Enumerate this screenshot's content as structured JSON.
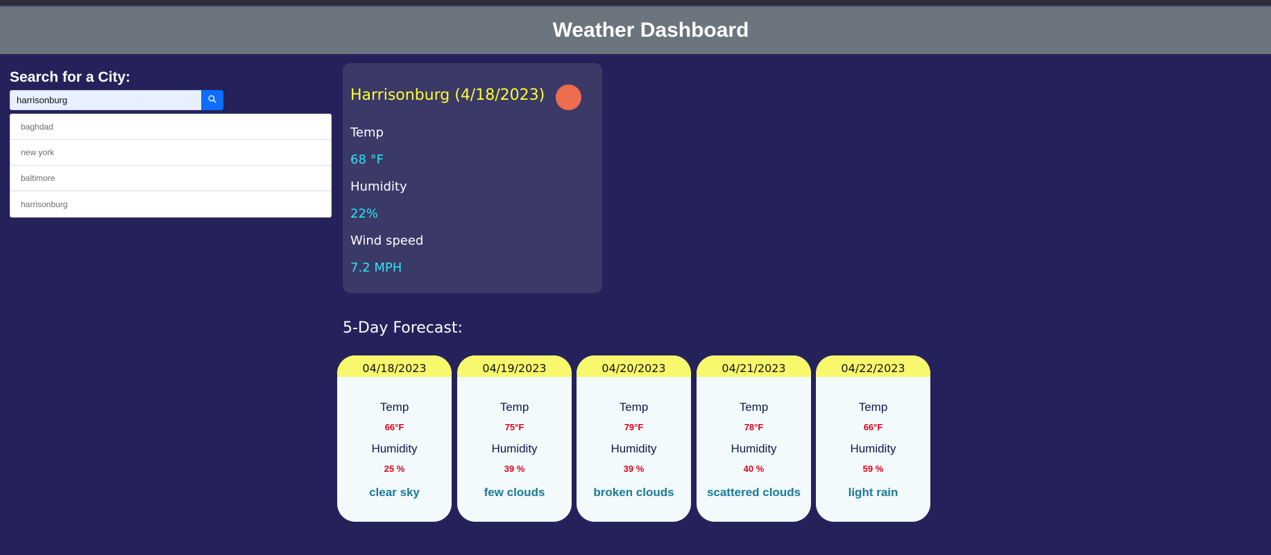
{
  "header": {
    "title": "Weather Dashboard"
  },
  "search": {
    "label": "Search for a City:",
    "value": "harrisonburg",
    "placeholder": "",
    "button_icon": "search-icon",
    "history": [
      "baghdad",
      "new york",
      "baltimore",
      "harrisonburg"
    ]
  },
  "current": {
    "title": "Harrisonburg (4/18/2023)",
    "icon": "weather-icon",
    "temp_label": "Temp",
    "temp_value": "68 °F",
    "humidity_label": "Humidity",
    "humidity_value": "22%",
    "wind_label": "Wind speed",
    "wind_value": "7.2 MPH"
  },
  "forecast": {
    "title": "5-Day Forecast:",
    "days": [
      {
        "date": "04/18/2023",
        "temp_label": "Temp",
        "temp": "66°F",
        "humidity_label": "Humidity",
        "humidity": "25 %",
        "desc": "clear sky"
      },
      {
        "date": "04/19/2023",
        "temp_label": "Temp",
        "temp": "75°F",
        "humidity_label": "Humidity",
        "humidity": "39 %",
        "desc": "few clouds"
      },
      {
        "date": "04/20/2023",
        "temp_label": "Temp",
        "temp": "79°F",
        "humidity_label": "Humidity",
        "humidity": "39 %",
        "desc": "broken clouds"
      },
      {
        "date": "04/21/2023",
        "temp_label": "Temp",
        "temp": "78°F",
        "humidity_label": "Humidity",
        "humidity": "40 %",
        "desc": "scattered clouds"
      },
      {
        "date": "04/22/2023",
        "temp_label": "Temp",
        "temp": "66°F",
        "humidity_label": "Humidity",
        "humidity": "59 %",
        "desc": "light rain"
      }
    ]
  },
  "colors": {
    "background": "#25225b",
    "header": "#6c757d",
    "card": "#3a3968",
    "accent_title": "#ffff2e",
    "accent_value": "#2ee6f2",
    "forecast_date_bg": "#f7f86c",
    "forecast_value": "#e0001e",
    "forecast_desc": "#1a7a9a",
    "button": "#0d6efd"
  }
}
